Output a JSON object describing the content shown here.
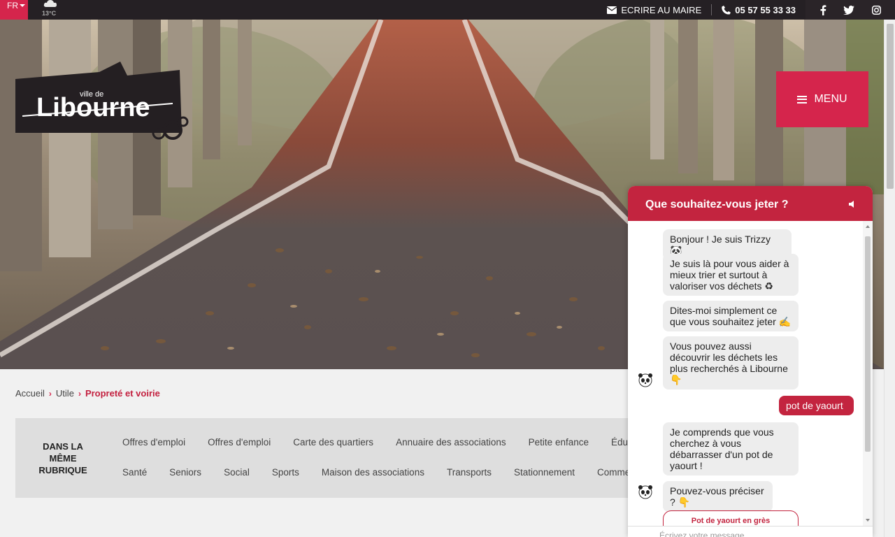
{
  "topbar": {
    "language": "FR",
    "weather": {
      "icon": "cloud-icon",
      "temperature": "13°C"
    },
    "write_mayor": "ECRIRE AU MAIRE",
    "phone": "05 57 55 33 33",
    "socials": [
      "facebook-icon",
      "twitter-icon",
      "instagram-icon"
    ]
  },
  "logo": {
    "prefix": "ville de",
    "name": "Libourne"
  },
  "menu": {
    "label": "MENU"
  },
  "breadcrumb": {
    "home": "Accueil",
    "parent": "Utile",
    "current": "Propreté et voirie"
  },
  "rubrique": {
    "title_line1": "DANS LA",
    "title_line2": "MÊME",
    "title_line3": "RUBRIQUE",
    "row1": [
      "Offres d'emploi",
      "Offres d'emploi",
      "Carte des quartiers",
      "Annuaire des associations",
      "Petite enfance",
      "Éducation"
    ],
    "row2": [
      "Santé",
      "Seniors",
      "Social",
      "Sports",
      "Maison des associations",
      "Transports",
      "Stationnement",
      "Commerce"
    ]
  },
  "chat": {
    "title": "Que souhaitez-vous jeter ?",
    "messages": [
      {
        "from": "bot",
        "text": "Bonjour ! Je suis Trizzy 🐼"
      },
      {
        "from": "bot",
        "text": "Je suis là pour vous aider à mieux trier et surtout à valoriser vos déchets ♻"
      },
      {
        "from": "bot",
        "text": "Dites-moi simplement ce que vous souhaitez jeter ✍"
      },
      {
        "from": "bot",
        "text": "Vous pouvez aussi découvrir les déchets les plus recherchés à Libourne 👇"
      },
      {
        "from": "user",
        "text": "pot de yaourt"
      },
      {
        "from": "bot",
        "text": "Je comprends que vous cherchez à vous débarrasser d'un pot de yaourt !"
      },
      {
        "from": "bot",
        "text": "Pouvez-vous préciser ? 👇"
      }
    ],
    "choice": "Pot de yaourt en grès",
    "input_placeholder": "Écrivez votre message..."
  },
  "colors": {
    "accent": "#c3243f",
    "topbar": "#252024"
  }
}
